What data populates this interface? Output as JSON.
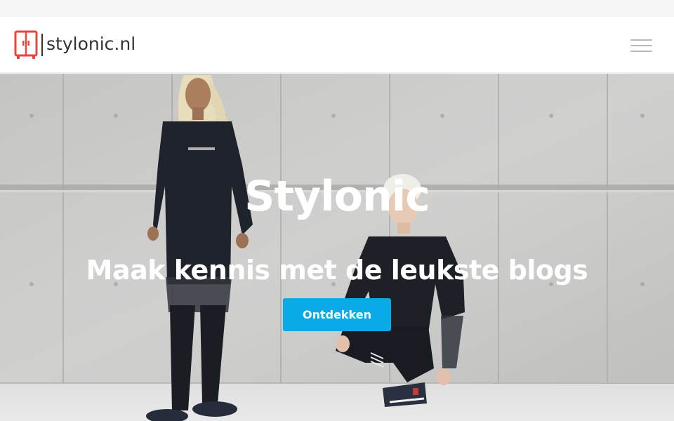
{
  "header": {
    "logo_text": "stylonic.nl",
    "logo_icon": "wardrobe-icon",
    "menu_icon": "hamburger-menu-icon"
  },
  "hero": {
    "title": "Stylonic",
    "subtitle": "Maak kennis met de leukste blogs",
    "cta_label": "Ontdekken",
    "photo": "two-models-in-black-against-concrete-wall"
  },
  "colors": {
    "brand_red": "#e8463e",
    "cta_blue": "#0aaae8",
    "logo_text": "#333333",
    "menu_lines": "#b9b9b9"
  }
}
